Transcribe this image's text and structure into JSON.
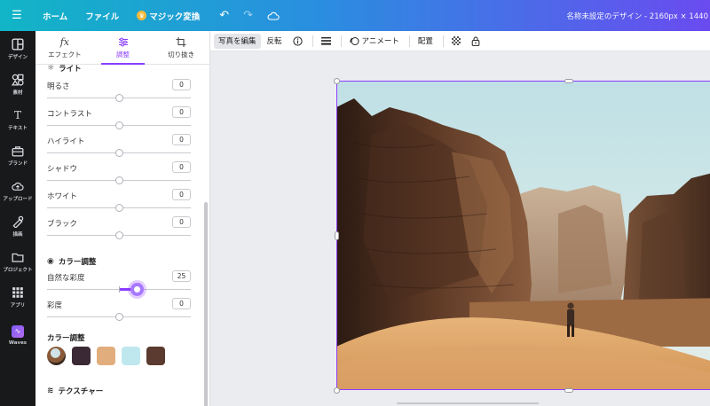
{
  "topbar": {
    "menu_icon": "hamburger-icon",
    "home": "ホーム",
    "file": "ファイル",
    "magic": "マジック変換",
    "undo_icon": "undo-icon",
    "redo_icon": "redo-icon",
    "cloud_icon": "cloud-icon",
    "title": "名称未設定のデザイン - 2160px × 1440"
  },
  "rail": {
    "items": [
      {
        "label": "デザイン",
        "icon": "layout-icon"
      },
      {
        "label": "素材",
        "icon": "shapes-icon"
      },
      {
        "label": "テキスト",
        "icon": "text-icon"
      },
      {
        "label": "ブランド",
        "icon": "brand-icon"
      },
      {
        "label": "アップロード",
        "icon": "cloud-upload-icon"
      },
      {
        "label": "描画",
        "icon": "draw-icon"
      },
      {
        "label": "プロジェクト",
        "icon": "folder-icon"
      },
      {
        "label": "アプリ",
        "icon": "apps-grid-icon"
      },
      {
        "label": "Waves",
        "icon": "waves-app-icon"
      }
    ]
  },
  "panel": {
    "tabs": [
      {
        "label": "エフェクト",
        "icon": "fx-icon",
        "active": false
      },
      {
        "label": "調整",
        "icon": "sliders-icon",
        "active": true
      },
      {
        "label": "切り抜き",
        "icon": "crop-icon",
        "active": false
      }
    ],
    "light_section": "ライト",
    "light_sliders": [
      {
        "label": "明るさ",
        "value": "0",
        "level": 0.5
      },
      {
        "label": "コントラスト",
        "value": "0",
        "level": 0.5
      },
      {
        "label": "ハイライト",
        "value": "0",
        "level": 0.5
      },
      {
        "label": "シャドウ",
        "value": "0",
        "level": 0.5
      },
      {
        "label": "ホワイト",
        "value": "0",
        "level": 0.5
      },
      {
        "label": "ブラック",
        "value": "0",
        "level": 0.5
      }
    ],
    "color_section": "カラー調整",
    "color_sliders": [
      {
        "label": "自然な彩度",
        "value": "25",
        "level": 0.625,
        "active": true
      },
      {
        "label": "彩度",
        "value": "0",
        "level": 0.5,
        "active": false
      }
    ],
    "palette_section": "カラー調整",
    "swatches": [
      "photo",
      "#3b2a36",
      "#e2ad7d",
      "#bfe8ee",
      "#5b3a2f"
    ],
    "texture_section": "テクスチャー"
  },
  "toolbar": {
    "edit_photo": "写真を編集",
    "flip": "反転",
    "info_icon": "info-icon",
    "lines_icon": "border-lines-icon",
    "animate_icon": "animate-icon",
    "animate": "アニメート",
    "position": "配置",
    "transparency_icon": "transparency-icon",
    "lock_icon": "lock-icon"
  },
  "canvas": {
    "image_subject": "desert-canyon-photo"
  }
}
